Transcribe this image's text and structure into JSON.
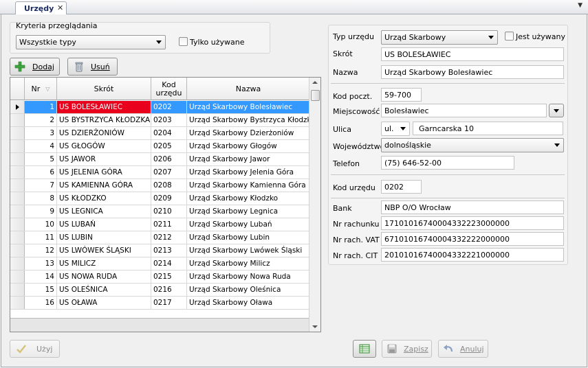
{
  "tab": {
    "title": "Urzędy",
    "close": "✕",
    "menu": "▼"
  },
  "criteria": {
    "title": "Kryteria przeglądania",
    "type_select": "Wszystkie typy",
    "only_used_label": "Tylko używane"
  },
  "toolbar": {
    "add_label": "Dodaj",
    "remove_label": "Usuń"
  },
  "grid": {
    "columns": {
      "nr": "Nr",
      "skrot": "Skrót",
      "kod_line1": "Kod",
      "kod_line2": "urzędu",
      "nazwa": "Nazwa"
    },
    "rows": [
      {
        "nr": "1",
        "skrot": "US BOLESŁAWIEC",
        "kod": "0202",
        "nazwa": "Urząd Skarbowy Bolesławiec"
      },
      {
        "nr": "2",
        "skrot": "US BYSTRZYCA KŁODZKA",
        "kod": "0203",
        "nazwa": "Urząd Skarbowy Bystrzyca Kłodzka"
      },
      {
        "nr": "3",
        "skrot": "US DZIERŻONIÓW",
        "kod": "0204",
        "nazwa": "Urząd Skarbowy Dzierżoniów"
      },
      {
        "nr": "4",
        "skrot": "US GŁOGÓW",
        "kod": "0205",
        "nazwa": "Urząd Skarbowy Głogów"
      },
      {
        "nr": "5",
        "skrot": "US JAWOR",
        "kod": "0206",
        "nazwa": "Urząd Skarbowy Jawor"
      },
      {
        "nr": "6",
        "skrot": "US JELENIA GÓRA",
        "kod": "0207",
        "nazwa": "Urząd Skarbowy Jelenia Góra"
      },
      {
        "nr": "7",
        "skrot": "US KAMIENNA GÓRA",
        "kod": "0208",
        "nazwa": "Urząd Skarbowy Kamienna Góra"
      },
      {
        "nr": "8",
        "skrot": "US KŁODZKO",
        "kod": "0209",
        "nazwa": "Urząd Skarbowy Kłodzko"
      },
      {
        "nr": "9",
        "skrot": "US LEGNICA",
        "kod": "0210",
        "nazwa": "Urząd Skarbowy Legnica"
      },
      {
        "nr": "10",
        "skrot": "US LUBAŃ",
        "kod": "0211",
        "nazwa": "Urząd Skarbowy Lubań"
      },
      {
        "nr": "11",
        "skrot": "US LUBIN",
        "kod": "0212",
        "nazwa": "Urząd Skarbowy Lubin"
      },
      {
        "nr": "12",
        "skrot": "US LWÓWEK ŚLĄSKI",
        "kod": "0213",
        "nazwa": "Urząd Skarbowy Lwówek Śląski"
      },
      {
        "nr": "13",
        "skrot": "US MILICZ",
        "kod": "0214",
        "nazwa": "Urząd Skarbowy Milicz"
      },
      {
        "nr": "14",
        "skrot": "US NOWA RUDA",
        "kod": "0215",
        "nazwa": "Urząd Skarbowy Nowa Ruda"
      },
      {
        "nr": "15",
        "skrot": "US OLEŚNICA",
        "kod": "0216",
        "nazwa": "Urząd Skarbowy Oleśnica"
      },
      {
        "nr": "16",
        "skrot": "US OŁAWA",
        "kod": "0217",
        "nazwa": "Urząd Skarbowy Oława"
      }
    ]
  },
  "details": {
    "typ_label": "Typ urzędu",
    "typ_value": "Urząd Skarbowy",
    "used_label": "Jest używany",
    "skrot_label": "Skrót",
    "skrot_value": "US BOLESŁAWIEC",
    "nazwa_label": "Nazwa",
    "nazwa_value": "Urząd Skarbowy Bolesławiec",
    "kod_poczt_label": "Kod poczt.",
    "kod_poczt_value": "59-700",
    "miejscowosc_label": "Miejscowość",
    "miejscowosc_value": "Bolesławiec",
    "ulica_label": "Ulica",
    "ulica_prefix": "ul.",
    "ulica_value": "Garncarska 10",
    "woj_label": "Województwo",
    "woj_value": "dolnośląskie",
    "telefon_label": "Telefon",
    "telefon_value": "(75) 646-52-00",
    "kod_urzedu_label": "Kod urzędu",
    "kod_urzedu_value": "0202",
    "bank_label": "Bank",
    "bank_value": "NBP O/O Wrocław",
    "nr_rach_label": "Nr rachunku",
    "nr_rach_value": "17101016740004332223000000",
    "nr_rach_vat_label": "Nr rach. VAT",
    "nr_rach_vat_value": "67101016740004332222000000",
    "nr_rach_cit_label": "Nr rach. CIT",
    "nr_rach_cit_value": "20101016740004332221000000"
  },
  "footer": {
    "use_label": "Użyj",
    "save_label": "Zapisz",
    "cancel_label": "Anuluj"
  },
  "colors": {
    "selection": "#3399ff",
    "selected_cell": "#e8001c"
  }
}
